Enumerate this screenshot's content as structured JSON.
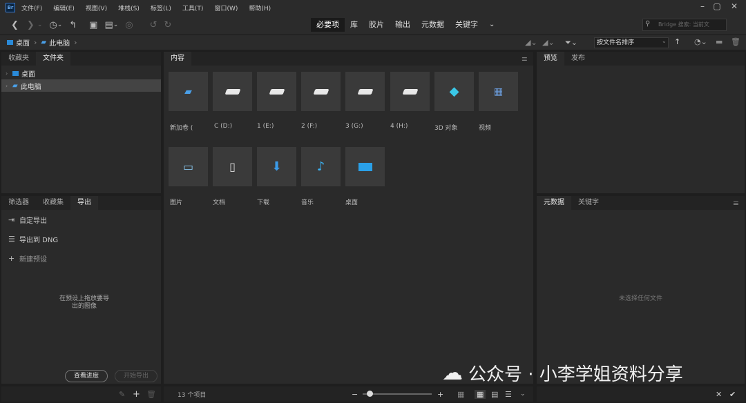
{
  "menu": [
    "文件(F)",
    "编辑(E)",
    "视图(V)",
    "堆栈(S)",
    "标签(L)",
    "工具(T)",
    "窗口(W)",
    "帮助(H)"
  ],
  "logo_text": "Br",
  "workspaces": [
    "必要项",
    "库",
    "胶片",
    "输出",
    "元数据",
    "关键字"
  ],
  "search_placeholder": "Bridge 搜索: 当前文",
  "breadcrumb": [
    "桌面",
    "此电脑"
  ],
  "sort_label": "按文件名排序",
  "left_top_tabs": [
    "收藏夹",
    "文件夹"
  ],
  "tree": [
    "桌面",
    "此电脑"
  ],
  "left_bottom_tabs": [
    "筛选器",
    "收藏集",
    "导出"
  ],
  "export_items": [
    "自定导出",
    "导出到 DNG",
    "新建预设"
  ],
  "export_hint": "在预设上拖放要导出的图像",
  "export_buttons": {
    "queue": "查看进度",
    "start": "开始导出"
  },
  "content_title": "内容",
  "tiles_row1_labels": [
    "新加卷 (",
    "C (D:)",
    "1 (E:)",
    "2 (F:)",
    "3 (G:)",
    "4 (H:)",
    "3D 对象",
    "视频"
  ],
  "tiles_row2_labels": [
    "图片",
    "文档",
    "下载",
    "音乐",
    "桌面"
  ],
  "status_count": "13 个项目",
  "right_top_tabs": [
    "预览",
    "发布"
  ],
  "right_bottom_tabs": [
    "元数据",
    "关键字"
  ],
  "no_file": "未选择任何文件",
  "watermark": "公众号 · 小李学姐资料分享",
  "colors": {
    "accent": "#2a8ad8",
    "panel": "#2a2a2a",
    "bg": "#1e1e1e"
  }
}
